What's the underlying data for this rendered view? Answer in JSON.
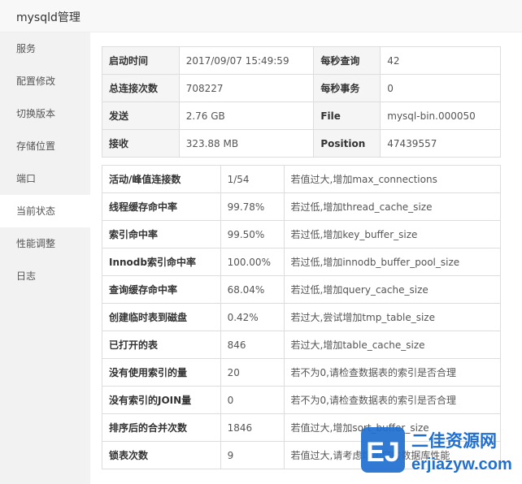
{
  "window": {
    "title": "mysqld管理"
  },
  "sidebar": {
    "items": [
      {
        "label": "服务"
      },
      {
        "label": "配置修改"
      },
      {
        "label": "切换版本"
      },
      {
        "label": "存储位置"
      },
      {
        "label": "端口"
      },
      {
        "label": "当前状态"
      },
      {
        "label": "性能调整"
      },
      {
        "label": "日志"
      }
    ],
    "active": "当前状态"
  },
  "overview": {
    "rows": [
      {
        "l1": "启动时间",
        "v1": "2017/09/07 15:49:59",
        "l2": "每秒查询",
        "v2": "42"
      },
      {
        "l1": "总连接次数",
        "v1": "708227",
        "l2": "每秒事务",
        "v2": "0"
      },
      {
        "l1": "发送",
        "v1": "2.76 GB",
        "l2": "File",
        "v2": "mysql-bin.000050"
      },
      {
        "l1": "接收",
        "v1": "323.88 MB",
        "l2": "Position",
        "v2": "47439557"
      }
    ]
  },
  "status": {
    "rows": [
      {
        "name": "活动/峰值连接数",
        "value": "1/54",
        "tip": "若值过大,增加max_connections"
      },
      {
        "name": "线程缓存命中率",
        "value": "99.78%",
        "tip": "若过低,增加thread_cache_size"
      },
      {
        "name": "索引命中率",
        "value": "99.50%",
        "tip": "若过低,增加key_buffer_size"
      },
      {
        "name": "Innodb索引命中率",
        "value": "100.00%",
        "tip": "若过低,增加innodb_buffer_pool_size"
      },
      {
        "name": "查询缓存命中率",
        "value": "68.04%",
        "tip": "若过低,增加query_cache_size"
      },
      {
        "name": "创建临时表到磁盘",
        "value": "0.42%",
        "tip": "若过大,尝试增加tmp_table_size"
      },
      {
        "name": "已打开的表",
        "value": "846",
        "tip": "若过大,增加table_cache_size"
      },
      {
        "name": "没有使用索引的量",
        "value": "20",
        "tip": "若不为0,请检查数据表的索引是否合理"
      },
      {
        "name": "没有索引的JOIN量",
        "value": "0",
        "tip": "若不为0,请检查数据表的索引是否合理"
      },
      {
        "name": "排序后的合并次数",
        "value": "1846",
        "tip": "若值过大,增加sort_buffer_size"
      },
      {
        "name": "锁表次数",
        "value": "9",
        "tip": "若值过大,请考虑增加您的数据库性能"
      }
    ]
  },
  "watermark": {
    "text_cn": "二佳资源网",
    "text_en": "erjiazyw.com",
    "logo": "EJ"
  }
}
